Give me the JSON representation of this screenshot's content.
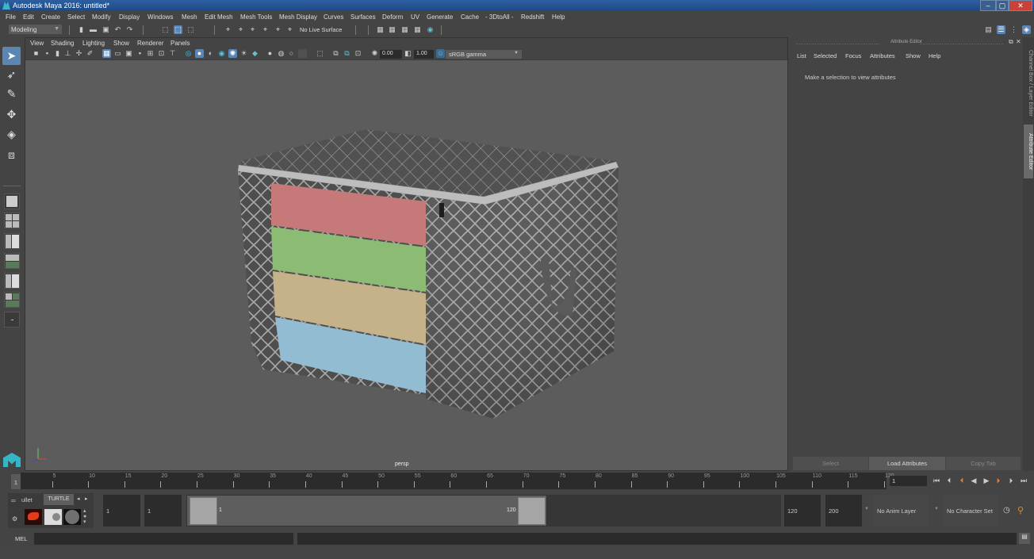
{
  "window": {
    "title": "Autodesk Maya 2016: untitled*",
    "controls": {
      "minimize": "–",
      "restore": "▢",
      "close": "✕"
    }
  },
  "menubar": {
    "items": [
      "File",
      "Edit",
      "Create",
      "Select",
      "Modify",
      "Display",
      "Windows",
      "Mesh",
      "Edit Mesh",
      "Mesh Tools",
      "Mesh Display",
      "Curves",
      "Surfaces",
      "Deform",
      "UV",
      "Generate",
      "Cache",
      "- 3DtoAll -",
      "Redshift",
      "Help"
    ]
  },
  "statusline": {
    "mode": "Modeling",
    "live_surface": "No Live Surface"
  },
  "viewport": {
    "menu": [
      "View",
      "Shading",
      "Lighting",
      "Show",
      "Renderer",
      "Panels"
    ],
    "exposure": "0.00",
    "gamma_value": "1.00",
    "color_space": "sRGB gamma",
    "camera_label": "persp",
    "model": "Storage box with rolled towels (pink, green, beige, blue) and quatrefoil pattern"
  },
  "attribute_editor": {
    "header": "Attribute Editor",
    "menu": [
      "List",
      "Selected",
      "Focus",
      "Attributes",
      "Show",
      "Help"
    ],
    "message": "Make a selection to view attributes",
    "buttons": {
      "select": "Select",
      "load": "Load Attributes",
      "copy_tab": "Copy Tab"
    }
  },
  "side_tabs": {
    "channel_box": "Channel Box / Layer Editor",
    "attribute_editor": "Attribute Editor"
  },
  "timeline": {
    "start_label": "1",
    "ticks": [
      5,
      10,
      15,
      20,
      25,
      30,
      35,
      40,
      45,
      50,
      55,
      60,
      65,
      70,
      75,
      80,
      85,
      90,
      95,
      100,
      105,
      110,
      115,
      120
    ],
    "current_frame": "1",
    "playback": [
      "go-to-start",
      "step-back-key",
      "step-back-frame",
      "play-back",
      "play-forward",
      "step-forward-frame",
      "step-forward-key",
      "go-to-end"
    ]
  },
  "range": {
    "shelf_tabs": [
      "ullet",
      "TURTLE"
    ],
    "start_time": "1",
    "playback_start": "1",
    "slider_start": "1",
    "slider_end": "120",
    "playback_end": "120",
    "end_time": "200",
    "anim_layer": "No Anim Layer",
    "character_set": "No Character Set"
  },
  "command_line": {
    "label": "MEL",
    "value": ""
  }
}
